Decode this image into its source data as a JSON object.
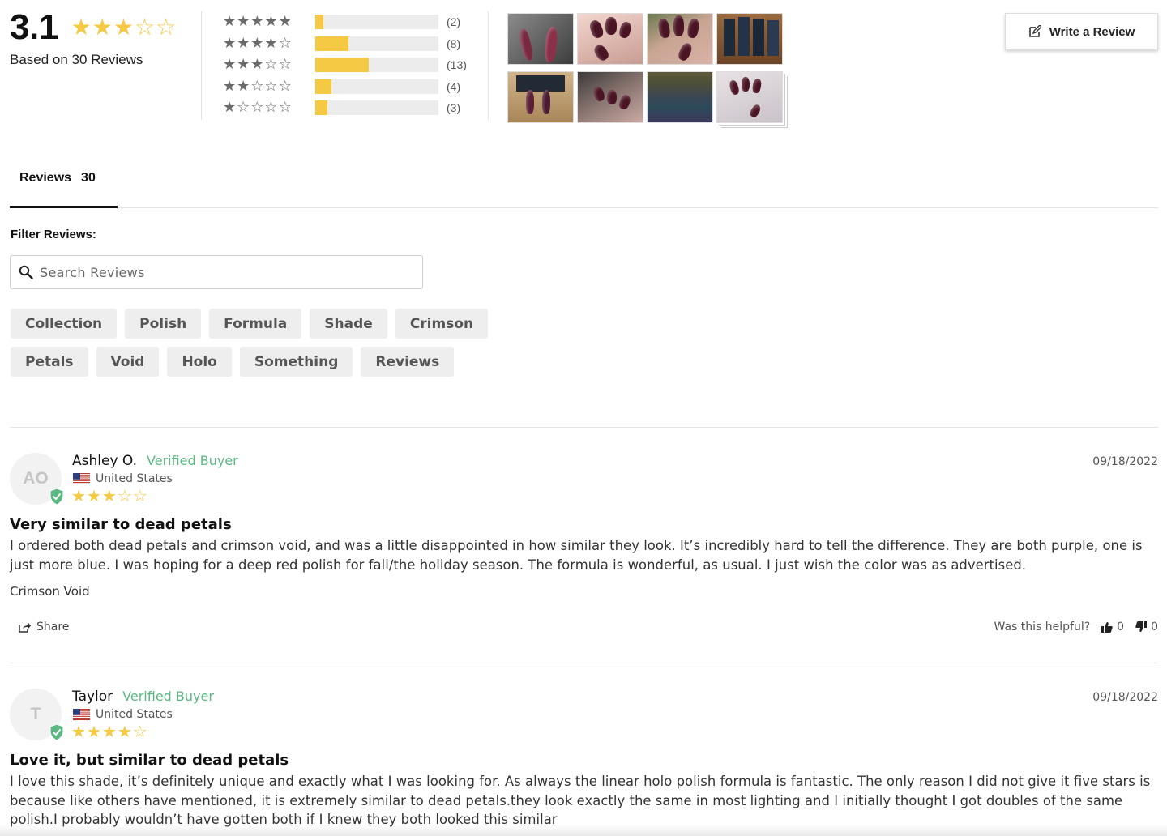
{
  "summary": {
    "average": "3.1",
    "average_value": 3.1,
    "based_on": "Based on 30 Reviews",
    "star_color": "#f6c944"
  },
  "histogram": [
    {
      "stars": 5,
      "count_label": "(2)",
      "count": 2
    },
    {
      "stars": 4,
      "count_label": "(8)",
      "count": 8
    },
    {
      "stars": 3,
      "count_label": "(13)",
      "count": 13
    },
    {
      "stars": 2,
      "count_label": "(4)",
      "count": 4
    },
    {
      "stars": 1,
      "count_label": "(3)",
      "count": 3
    }
  ],
  "gallery": {
    "photos": [
      "photo-1",
      "photo-2",
      "photo-3",
      "photo-4",
      "photo-5",
      "photo-6",
      "photo-7",
      "photo-8"
    ]
  },
  "write_review": {
    "label": "Write a Review",
    "icon": "edit-icon"
  },
  "tabs": {
    "active_label": "Reviews",
    "active_count": "30"
  },
  "filter": {
    "label": "Filter Reviews:",
    "search_placeholder": "Search Reviews",
    "chips": [
      "Collection",
      "Polish",
      "Formula",
      "Shade",
      "Crimson",
      "Petals",
      "Void",
      "Holo",
      "Something",
      "Reviews"
    ]
  },
  "reviews": [
    {
      "initials": "AO",
      "name": "Ashley O.",
      "verified": "Verified Buyer",
      "location": "United States",
      "rating": 3,
      "date": "09/18/2022",
      "title": "Very similar to dead petals",
      "body": "I ordered both dead petals and crimson void, and was a little disappointed in how similar they look. It’s incredibly hard to tell the difference. They are both purple, one is just more blue. I was hoping for a deep red polish for fall/the holiday season. The formula is wonderful, as usual. I just wish the color was as advertised.",
      "variant": "Crimson Void",
      "share": "Share",
      "helpful_label": "Was this helpful?",
      "up": "0",
      "down": "0"
    },
    {
      "initials": "T",
      "name": "Taylor",
      "verified": "Verified Buyer",
      "location": "United States",
      "rating": 4,
      "date": "09/18/2022",
      "title": "Love it, but similar to dead petals",
      "body": "I love this shade, it’s definitely unique and exactly what I was looking for. As always the linear holo polish formula is fantastic. The only reason I did not give it five stars is because like others have mentioned, it is extremely similar to dead petals.they look exactly the same in most lighting and I initially thought I got doubles of the same polish.I probably wouldn’t have gotten both if I knew they both looked this similar"
    }
  ],
  "colors": {
    "verified_green": "#5cb882",
    "bar_fill": "#f6c944",
    "bar_track": "#ececec",
    "chip_bg": "#eeeeee"
  }
}
